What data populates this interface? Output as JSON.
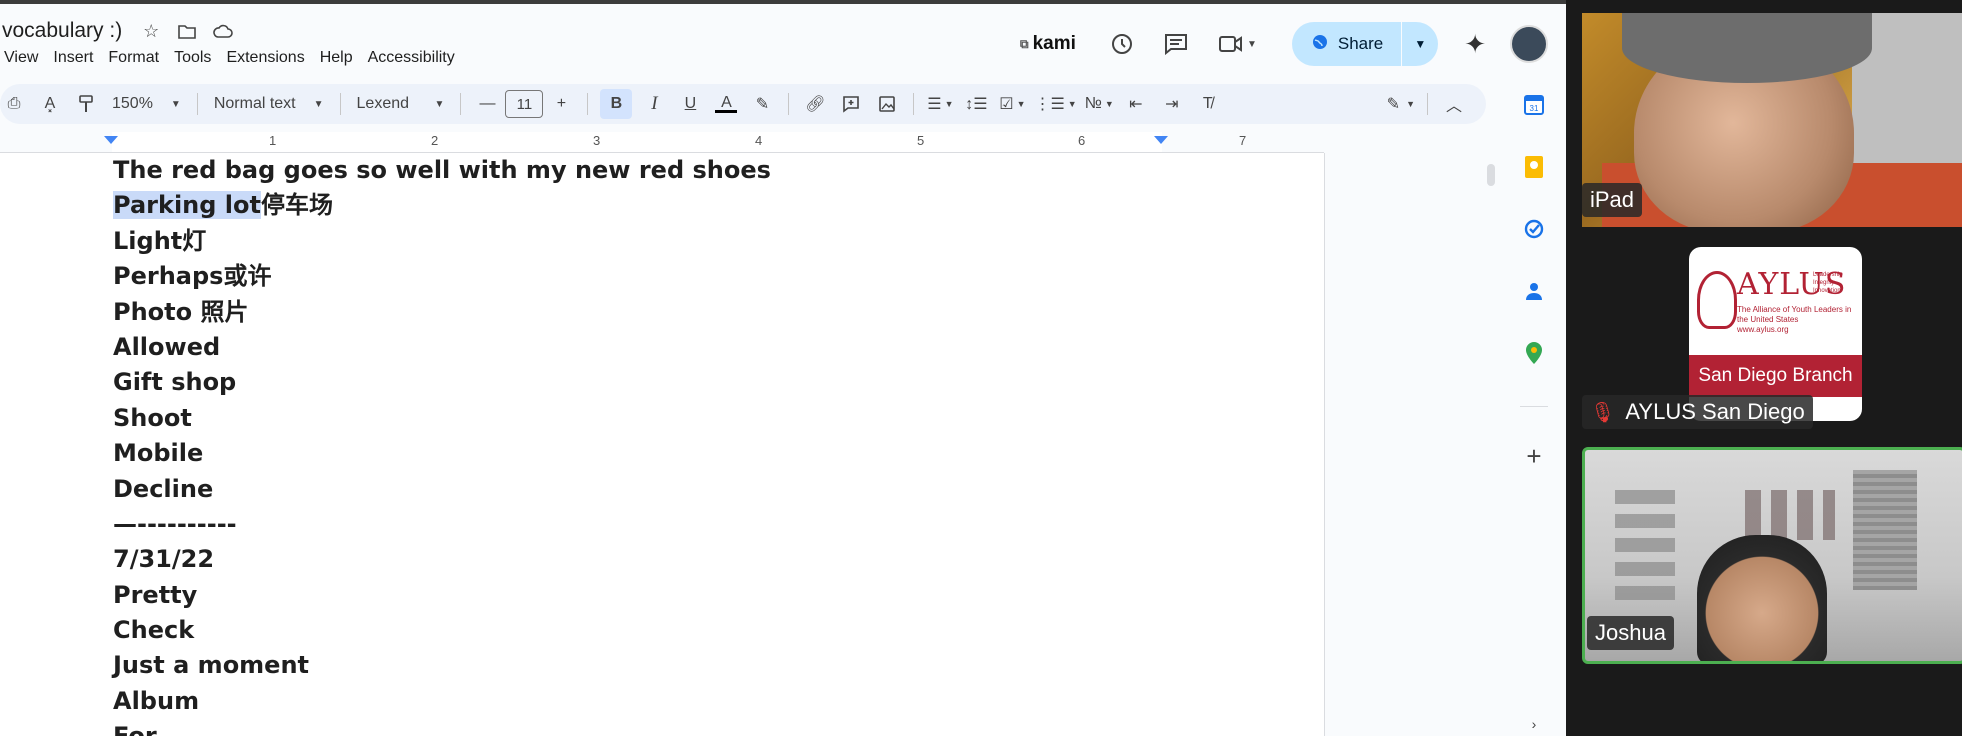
{
  "doc": {
    "title": "vocabulary :)",
    "menu": [
      "View",
      "Insert",
      "Format",
      "Tools",
      "Extensions",
      "Help",
      "Accessibility"
    ],
    "extension_label": "kami",
    "share_label": "Share",
    "toolbar": {
      "zoom": "150%",
      "style": "Normal text",
      "font": "Lexend",
      "font_size": "11"
    },
    "ruler_numbers": [
      "1",
      "2",
      "3",
      "4",
      "5",
      "6",
      "7"
    ],
    "lines": [
      "The red bag goes so well with my new red shoes",
      "停车场",
      "Light灯",
      "Perhaps或许",
      "Photo 照片",
      "Allowed",
      "Gift shop",
      "Shoot",
      "Mobile",
      "Decline",
      "—----------",
      "7/31/22",
      "Pretty",
      "Check",
      "Just a moment",
      "Album",
      "For..."
    ],
    "selected_text": "Parking lot"
  },
  "meeting": {
    "participants": [
      {
        "name": "iPad"
      },
      {
        "name": "AYLUS San Diego",
        "muted": true
      },
      {
        "name": "Joshua",
        "active_speaker": true
      }
    ],
    "logo": {
      "title": "AYLUS",
      "tagline": "Leadership Integrity Innovation",
      "subtitle": "The Alliance of Youth Leaders in the United States",
      "url": "www.aylus.org",
      "band": "San Diego Branch"
    }
  },
  "colors": {
    "share_bg": "#c2e7ff",
    "selection": "#c9daf8",
    "brand_red": "#b22234",
    "speaker_border": "#4caf50"
  }
}
